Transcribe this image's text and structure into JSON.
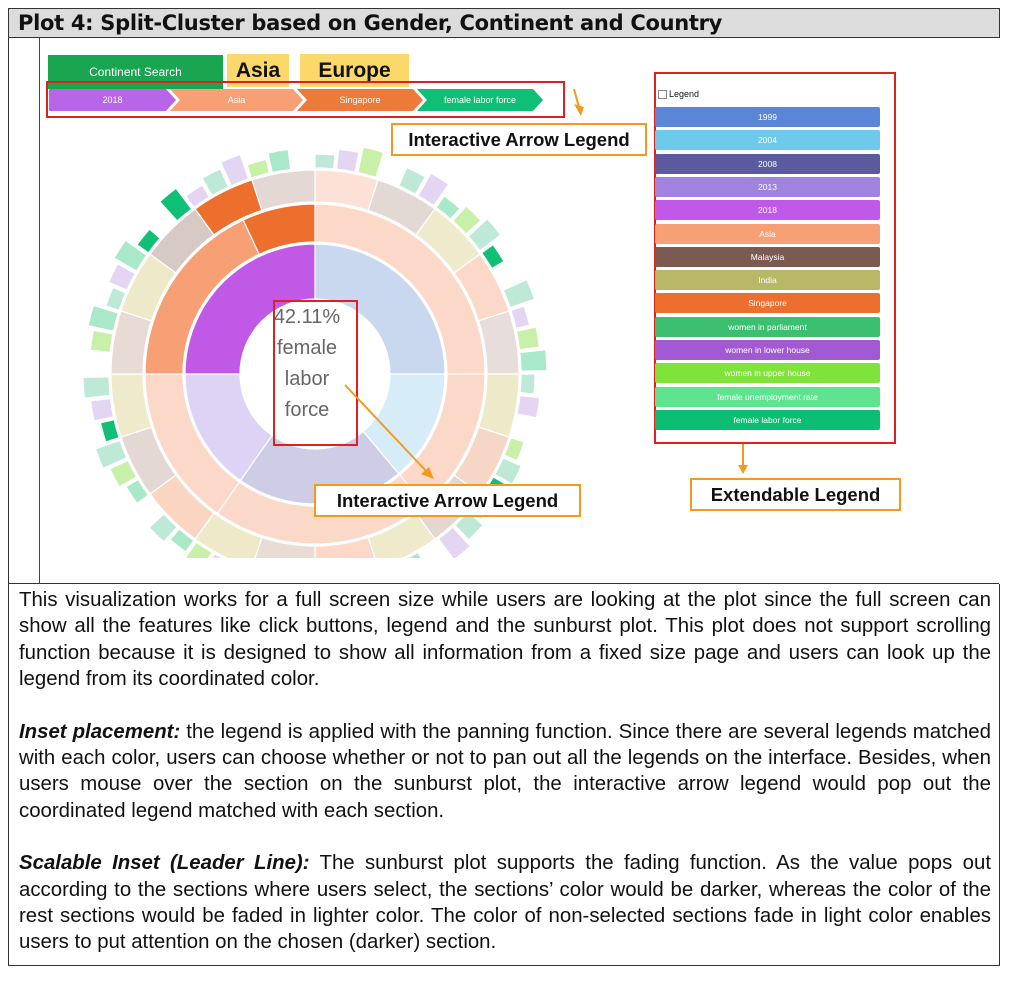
{
  "title": "Plot 4: Split-Cluster based on Gender, Continent and Country",
  "ui": {
    "continent_search": "Continent Search",
    "tags": [
      "Asia",
      "Europe"
    ],
    "breadcrumbs": [
      {
        "label": "2018",
        "color": "#b865e8"
      },
      {
        "label": "Asia",
        "color": "#f7a076"
      },
      {
        "label": "Singapore",
        "color": "#ee7a3a"
      },
      {
        "label": "female labor force",
        "color": "#0fbf76"
      }
    ],
    "center_lines": [
      "42.11%",
      "female",
      "labor",
      "force"
    ],
    "callout_top": "Interactive Arrow Legend",
    "callout_bottom": "Interactive Arrow Legend",
    "callout_legend": "Extendable Legend",
    "legend_title": "Legend",
    "legend_items": [
      {
        "label": "1999",
        "color": "#5b86d8"
      },
      {
        "label": "2004",
        "color": "#6fc9ea"
      },
      {
        "label": "2008",
        "color": "#5b5a9e"
      },
      {
        "label": "2013",
        "color": "#9f83de"
      },
      {
        "label": "2018",
        "color": "#c058e8"
      },
      {
        "label": "Asia",
        "color": "#f7a076"
      },
      {
        "label": "Malaysia",
        "color": "#7a5a52"
      },
      {
        "label": "India",
        "color": "#b8b867"
      },
      {
        "label": "Singapore",
        "color": "#ed6f2e"
      },
      {
        "label": "women in parliament",
        "color": "#3dbf72"
      },
      {
        "label": "women in lower house",
        "color": "#a25ad4"
      },
      {
        "label": "women in upper house",
        "color": "#7fe33a"
      },
      {
        "label": "female unemployment rate",
        "color": "#5ee48f"
      },
      {
        "label": "female labor force",
        "color": "#0cbd74"
      }
    ]
  },
  "description": {
    "p1": "This visualization works for a full screen size while users are looking at the plot since the full screen can show all the features like click buttons, legend and the sunburst plot. This plot does not support scrolling function because it is designed to show all information from a fixed size page and users can look up the legend from its coordinated color.",
    "p2_head": "Inset placement:",
    "p2_body": " the legend is applied with the panning function. Since there are several legends matched with each color, users can choose whether or not to pan out all the legends on the interface. Besides, when users mouse over the section on the sunburst plot, the interactive arrow legend would pop out the coordinated legend matched with each section.",
    "p3_head": "Scalable Inset (Leader Line):",
    "p3_body": " The sunburst plot supports the fading function. As the value pops out according to the sections where users select, the sections’ color would be darker, whereas the color of the rest sections would be faded in lighter color. The color of non-selected sections fade in light color enables users to put attention on the chosen (darker) section."
  }
}
